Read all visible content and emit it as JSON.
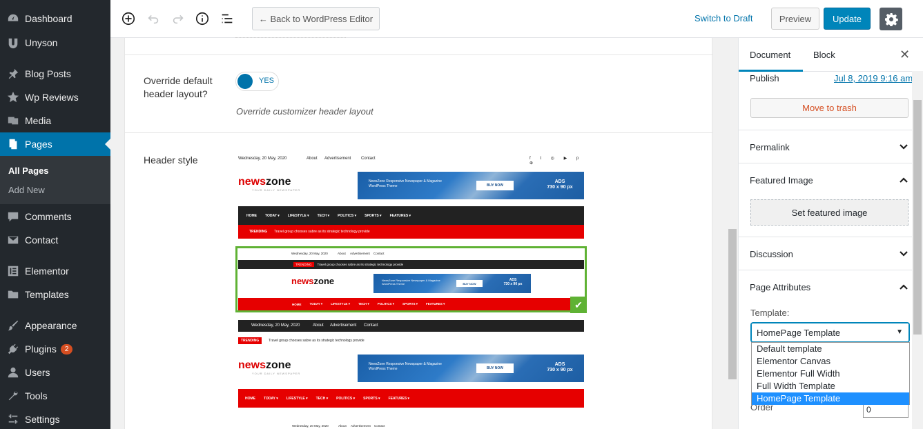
{
  "sidebar": {
    "items": [
      {
        "label": "Dashboard",
        "icon": "dashboard-icon"
      },
      {
        "label": "Unyson",
        "icon": "unyson-icon"
      },
      {
        "label": "Blog Posts",
        "icon": "pin-icon"
      },
      {
        "label": "Wp Reviews",
        "icon": "star-icon"
      },
      {
        "label": "Media",
        "icon": "media-icon"
      },
      {
        "label": "Pages",
        "icon": "pages-icon"
      },
      {
        "label": "Comments",
        "icon": "comments-icon"
      },
      {
        "label": "Contact",
        "icon": "mail-icon"
      },
      {
        "label": "Elementor",
        "icon": "elementor-icon"
      },
      {
        "label": "Templates",
        "icon": "folder-icon"
      },
      {
        "label": "Appearance",
        "icon": "brush-icon"
      },
      {
        "label": "Plugins",
        "icon": "plug-icon",
        "badge": "2"
      },
      {
        "label": "Users",
        "icon": "users-icon"
      },
      {
        "label": "Tools",
        "icon": "wrench-icon"
      },
      {
        "label": "Settings",
        "icon": "settings-icon"
      }
    ],
    "sub": {
      "all_pages": "All Pages",
      "add_new": "Add New"
    }
  },
  "toolbar": {
    "back": "← Back to WordPress Editor",
    "switch_draft": "Switch to Draft",
    "preview": "Preview",
    "update": "Update"
  },
  "main": {
    "override_label": "Override default header layout?",
    "toggle_value": "YES",
    "override_desc": "Override customizer header layout",
    "header_style_label": "Header style",
    "preview": {
      "date": "Wednesday, 20 May, 2020",
      "links": [
        "About",
        "Advertisement",
        "Contact"
      ],
      "logo_a": "news",
      "logo_b": "zone",
      "tagline": "YOUR DAILY NEWSPAPER",
      "ad_text": "NewsZone Responsive Newspaper & Magazine WordPress Theme",
      "ad_button": "BUY NOW",
      "ad_label": "ADS",
      "ad_size": "730 x 90 px",
      "nav": [
        "HOME",
        "TODAY ▾",
        "LIFESTYLE ▾",
        "TECH ▾",
        "POLITICS ▾",
        "SPORTS ▾",
        "FEATURES ▾"
      ],
      "trending_label": "TRENDING",
      "trending_text": "Travel group chooses sabre as its strategic technology provide"
    }
  },
  "panel": {
    "tabs": {
      "document": "Document",
      "block": "Block"
    },
    "publish_label": "Publish",
    "publish_date": "Jul 8, 2019 9:16 am",
    "trash": "Move to trash",
    "permalink": "Permalink",
    "featured_image": "Featured Image",
    "set_featured": "Set featured image",
    "discussion": "Discussion",
    "page_attributes": "Page Attributes",
    "template_label": "Template:",
    "template_value": "HomePage Template",
    "template_options": [
      "Default template",
      "Elementor Canvas",
      "Elementor Full Width",
      "Full Width Template",
      "HomePage Template"
    ],
    "order_label": "Order",
    "order_value": "0"
  },
  "colors": {
    "accent": "#0073aa",
    "sidebar": "#23282d",
    "red": "#e60000",
    "selected_border": "#5fb234"
  }
}
